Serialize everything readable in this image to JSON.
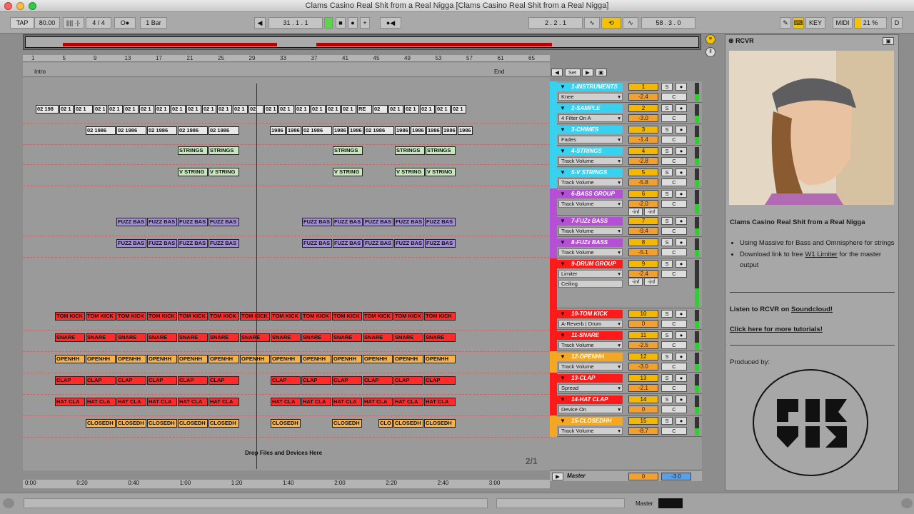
{
  "window": {
    "title": "Clams Casino Real Shit from a Real Nigga  [Clams Casino Real Shit from a Real Nigga]"
  },
  "transport": {
    "tap": "TAP",
    "tempo": "80.00",
    "meter_sig": "4 / 4",
    "quantize": "1 Bar",
    "position": "31 .   1 .   1",
    "loop_start": "2 .   2 .   1",
    "loop_length": "58 .   3 .   0",
    "key": "KEY",
    "midi": "MIDI",
    "cpu": "21 %",
    "disk": "D"
  },
  "arrangement": {
    "ruler": [
      "1",
      "5",
      "9",
      "13",
      "17",
      "21",
      "25",
      "29",
      "33",
      "37",
      "41",
      "45",
      "49",
      "53",
      "57",
      "61",
      "65"
    ],
    "locators": {
      "start": "Intro",
      "end": "End"
    },
    "drop_hint": "Drop Files and Devices Here",
    "time_labels": [
      "0:00",
      "0:20",
      "0:40",
      "1:00",
      "1:20",
      "1:40",
      "2:00",
      "2:20",
      "2:40",
      "3:00"
    ],
    "grid_label": "2/1",
    "lanes": [
      {
        "clips": [
          [
            "02 198",
            18,
            50
          ],
          [
            "02 1",
            51,
            71
          ],
          [
            "02 1",
            72,
            98
          ],
          [
            "02 1",
            99,
            118
          ],
          [
            "02 1",
            119,
            140
          ],
          [
            "02 1",
            141,
            162
          ],
          [
            "02 1",
            163,
            184
          ],
          [
            "02 1",
            185,
            206
          ],
          [
            "02 1",
            207,
            228
          ],
          [
            "02 1",
            229,
            250
          ],
          [
            "02 1",
            251,
            271
          ],
          [
            "02 1",
            272,
            293
          ],
          [
            "02 1",
            294,
            315
          ],
          [
            "02",
            316,
            337
          ],
          [
            "02 1",
            338,
            357
          ],
          [
            "02 1",
            358,
            380
          ],
          [
            "02 1",
            381,
            402
          ],
          [
            "02 1",
            403,
            424
          ],
          [
            "02 1",
            425,
            445
          ],
          [
            "02 1",
            446,
            467
          ],
          [
            "RE",
            468,
            489
          ],
          [
            "02",
            490,
            511
          ],
          [
            "02 1",
            512,
            533
          ],
          [
            "02 1",
            534,
            555
          ],
          [
            "02 1",
            556,
            577
          ],
          [
            "02 1",
            578,
            599
          ],
          [
            "02 1",
            600,
            621
          ]
        ],
        "color": "#e8e8e8"
      },
      {
        "clips": [
          [
            "02 1986",
            88,
            130
          ],
          [
            "02 1986",
            131,
            173
          ],
          [
            "02 1986",
            174,
            216
          ],
          [
            "02 1986",
            217,
            259
          ],
          [
            "02 1986",
            260,
            303
          ],
          [
            "1986",
            346,
            368
          ],
          [
            "1986",
            369,
            390
          ],
          [
            "02 1986",
            391,
            433
          ],
          [
            "1986",
            434,
            455
          ],
          [
            "1986",
            456,
            477
          ],
          [
            "02 1986",
            478,
            520
          ],
          [
            "1986",
            521,
            542
          ],
          [
            "1986",
            543,
            564
          ],
          [
            "1986",
            565,
            586
          ],
          [
            "1986",
            587,
            608
          ],
          [
            "1986",
            609,
            630
          ]
        ],
        "color": "#e8e8e8"
      },
      {
        "clips": [
          [
            "STRINGS",
            217,
            259
          ],
          [
            "STRINGS",
            260,
            303
          ],
          [
            "STRINGS",
            434,
            476
          ],
          [
            "STRINGS",
            521,
            563
          ],
          [
            "STRINGS",
            564,
            606
          ]
        ],
        "color": "#c8e7bd"
      },
      {
        "clips": [
          [
            "V STRING",
            217,
            259
          ],
          [
            "V STRING",
            260,
            303
          ],
          [
            "V STRING",
            434,
            476
          ],
          [
            "V STRING",
            521,
            563
          ],
          [
            "V STRING",
            564,
            606
          ]
        ],
        "color": "#c8e7bd"
      },
      {
        "clips": [
          [
            "FUZZ BAS",
            131,
            173
          ],
          [
            "FUZZ BAS",
            174,
            216
          ],
          [
            "FUZZ BAS",
            217,
            259
          ],
          [
            "FUZZ BAS",
            260,
            303
          ],
          [
            "FUZZ BAS",
            391,
            433
          ],
          [
            "FUZZ BAS",
            434,
            476
          ],
          [
            "FUZZ BAS",
            477,
            519
          ],
          [
            "FUZZ BAS",
            520,
            562
          ],
          [
            "FUZZ BAS",
            563,
            606
          ]
        ],
        "color": "#a38bde"
      },
      {
        "clips": [
          [
            "FUZZ BAS",
            131,
            173
          ],
          [
            "FUZZ BAS",
            174,
            216
          ],
          [
            "FUZZ BAS",
            217,
            259
          ],
          [
            "FUZZ BAS",
            260,
            303
          ],
          [
            "FUZZ BAS",
            391,
            433
          ],
          [
            "FUZZ BAS",
            434,
            476
          ],
          [
            "FUZZ BAS",
            477,
            519
          ],
          [
            "FUZZ BAS",
            520,
            562
          ],
          [
            "FUZZ BAS",
            563,
            606
          ]
        ],
        "color": "#a38bde"
      },
      {
        "clips": [
          [
            "TOM KICK",
            45,
            87
          ],
          [
            "TOM KICK",
            88,
            130
          ],
          [
            "TOM KICK",
            131,
            173
          ],
          [
            "TOM KICK",
            174,
            216
          ],
          [
            "TOM KICK",
            217,
            259
          ],
          [
            "TOM KICK",
            260,
            303
          ],
          [
            "TOM KICK",
            304,
            346
          ],
          [
            "TOM KICK",
            347,
            389
          ],
          [
            "TOM KICK",
            390,
            432
          ],
          [
            "TOM KICK",
            433,
            475
          ],
          [
            "TOM KICK",
            476,
            518
          ],
          [
            "TOM KICK",
            519,
            561
          ],
          [
            "TOM KICK",
            562,
            606
          ]
        ],
        "color": "#ff2a2a"
      },
      {
        "clips": [
          [
            "SNARE",
            45,
            87
          ],
          [
            "SNARE",
            88,
            130
          ],
          [
            "SNARE",
            131,
            173
          ],
          [
            "SNARE",
            174,
            216
          ],
          [
            "SNARE",
            217,
            259
          ],
          [
            "SNARE",
            260,
            303
          ],
          [
            "SNARE",
            304,
            346
          ],
          [
            "SNARE",
            347,
            389
          ],
          [
            "SNARE",
            390,
            432
          ],
          [
            "SNARE",
            433,
            475
          ],
          [
            "SNARE",
            476,
            518
          ],
          [
            "SNARE",
            519,
            561
          ],
          [
            "SNARE",
            562,
            606
          ]
        ],
        "color": "#ff2a2a"
      },
      {
        "clips": [
          [
            "OPENHH",
            45,
            87
          ],
          [
            "OPENHH",
            88,
            130
          ],
          [
            "OPENHH",
            131,
            173
          ],
          [
            "OPENHH",
            174,
            216
          ],
          [
            "OPENHH",
            217,
            259
          ],
          [
            "OPENHH",
            260,
            303
          ],
          [
            "OPENHH",
            304,
            346
          ],
          [
            "OPENHH",
            347,
            389
          ],
          [
            "OPENHH",
            390,
            432
          ],
          [
            "OPENHH",
            433,
            475
          ],
          [
            "OPENHH",
            476,
            518
          ],
          [
            "OPENHH",
            519,
            561
          ],
          [
            "OPENHH",
            562,
            606
          ]
        ],
        "color": "#f9b24a"
      },
      {
        "clips": [
          [
            "CLAP",
            45,
            87
          ],
          [
            "CLAP",
            88,
            130
          ],
          [
            "CLAP",
            131,
            173
          ],
          [
            "CLAP",
            174,
            216
          ],
          [
            "CLAP",
            217,
            259
          ],
          [
            "CLAP",
            260,
            303
          ],
          [
            "CLAP",
            347,
            389
          ],
          [
            "CLAP",
            390,
            432
          ],
          [
            "CLAP",
            433,
            475
          ],
          [
            "CLAP",
            476,
            518
          ],
          [
            "CLAP",
            519,
            561
          ],
          [
            "CLAP",
            562,
            606
          ]
        ],
        "color": "#ff2a2a"
      },
      {
        "clips": [
          [
            "HAT CLA",
            45,
            87
          ],
          [
            "HAT CLA",
            88,
            130
          ],
          [
            "HAT CLA",
            131,
            173
          ],
          [
            "HAT CLA",
            174,
            216
          ],
          [
            "HAT CLA",
            217,
            259
          ],
          [
            "HAT CLA",
            260,
            303
          ],
          [
            "HAT CLA",
            347,
            389
          ],
          [
            "HAT CLA",
            390,
            432
          ],
          [
            "HAT CLA",
            433,
            475
          ],
          [
            "HAT CLA",
            476,
            518
          ],
          [
            "HAT CLA",
            519,
            561
          ],
          [
            "HAT CLA",
            562,
            606
          ]
        ],
        "color": "#ff2a2a"
      },
      {
        "clips": [
          [
            "CLOSEDH",
            88,
            130
          ],
          [
            "CLOSEDH",
            131,
            173
          ],
          [
            "CLOSEDH",
            174,
            216
          ],
          [
            "CLOSEDH",
            217,
            259
          ],
          [
            "CLOSEDH",
            260,
            303
          ],
          [
            "CLOSEDH",
            347,
            389
          ],
          [
            "CLOSEDH",
            433,
            475
          ],
          [
            "CLO",
            498,
            518
          ],
          [
            "CLOSEDH",
            519,
            561
          ],
          [
            "CLOSEDH",
            562,
            606
          ]
        ],
        "color": "#f9b24a"
      }
    ]
  },
  "mixer": {
    "set_label": "Set",
    "tracks": [
      {
        "name": "1-INSTRUMENTS",
        "device": "Knee",
        "num": "1",
        "vol": "-2.4",
        "color": "#38d1f0",
        "group": true
      },
      {
        "name": "2-SAMPLE",
        "device": "4 Filter On A",
        "num": "2",
        "vol": "-3.0",
        "color": "#38d1f0"
      },
      {
        "name": "3-CHIMES",
        "device": "Fades",
        "num": "3",
        "vol": "-1.4",
        "color": "#38d1f0"
      },
      {
        "name": "4-STRINGS",
        "device": "Track Volume",
        "num": "4",
        "vol": "-2.8",
        "color": "#38d1f0"
      },
      {
        "name": "5-V STRINGS",
        "device": "Track Volume",
        "num": "5",
        "vol": "-5.8",
        "color": "#38d1f0"
      },
      {
        "name": "6-BASS GROUP",
        "device": "Track Volume",
        "num": "6",
        "vol": "-2.0",
        "color": "#b44fd6",
        "group": true
      },
      {
        "name": "7-FUZz BASS",
        "device": "Track Volume",
        "num": "7",
        "vol": "-9.4",
        "color": "#b44fd6"
      },
      {
        "name": "8-FUZz BASS",
        "device": "Track Volume",
        "num": "8",
        "vol": "-5.1",
        "color": "#b44fd6"
      },
      {
        "name": "9-DRUM GROUP",
        "device": "Limiter",
        "device2": "Ceiling",
        "num": "9",
        "vol": "-2.4",
        "color": "#ff1a1a",
        "group": true
      },
      {
        "name": "10-TOM KICK",
        "device": "A-Reverb | Drum",
        "num": "10",
        "vol": "0",
        "color": "#ff1a1a"
      },
      {
        "name": "11-SNARE",
        "device": "Track Volume",
        "num": "11",
        "vol": "-2.5",
        "color": "#ff1a1a"
      },
      {
        "name": "12-OPENHH",
        "device": "Track Volume",
        "num": "12",
        "vol": "-3.0",
        "color": "#f5a623"
      },
      {
        "name": "13-CLAP",
        "device": "Spread",
        "num": "13",
        "vol": "-2.1",
        "color": "#ff1a1a"
      },
      {
        "name": "14-HAT CLAP",
        "device": "Device On",
        "num": "14",
        "vol": "0",
        "color": "#ff1a1a"
      },
      {
        "name": "15-CLOSEDHH",
        "device": "Track Volume",
        "num": "15",
        "vol": "-8.7",
        "color": "#f5a623"
      }
    ],
    "master": {
      "name": "Master",
      "vol": "0",
      "pan": "-3.0"
    },
    "inf_labels": [
      "-inf",
      "-inf"
    ]
  },
  "info_panel": {
    "tab": "RCVR",
    "heading": "Clams Casino Real Shit from a Real Nigga",
    "bullet1": "Using Massive for Bass and Omnisphere for strings",
    "bullet2_pre": "Download link to free ",
    "bullet2_link": "W1 Limiter",
    "bullet2_post": " for the master output",
    "listen_pre": "Listen to RCVR on ",
    "listen_link": "Soundcloud!",
    "tutorials": "Click here for more tutorials!",
    "produced_by": "Produced by:"
  },
  "statusbar": {
    "master_label": "Master"
  }
}
